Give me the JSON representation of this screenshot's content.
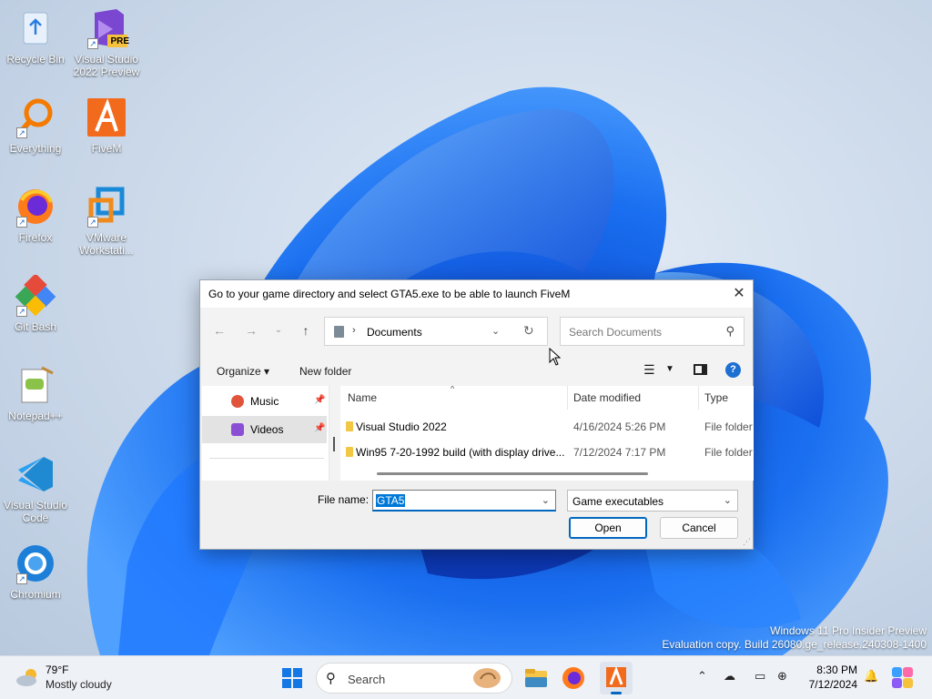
{
  "desktop": {
    "icons": [
      {
        "label": "Recycle Bin",
        "icon": "recycle-bin-icon"
      },
      {
        "label": "Visual Studio 2022 Preview",
        "icon": "visual-studio-preview-icon",
        "badge": "PRE"
      },
      {
        "label": "Everything",
        "icon": "everything-search-icon"
      },
      {
        "label": "FiveM",
        "icon": "fivem-icon"
      },
      {
        "label": "Firefox",
        "icon": "firefox-icon"
      },
      {
        "label": "VMware Workstati...",
        "icon": "vmware-icon"
      },
      {
        "label": "Git Bash",
        "icon": "git-bash-icon"
      },
      {
        "label": "Notepad++",
        "icon": "notepadpp-icon"
      },
      {
        "label": "Visual Studio Code",
        "icon": "vscode-icon"
      },
      {
        "label": "Chromium",
        "icon": "chromium-icon"
      }
    ],
    "watermark": {
      "line1": "Windows 11 Pro Insider Preview",
      "line2": "Evaluation copy. Build 26080.ge_release.240308-1400"
    }
  },
  "dialog": {
    "title": "Go to your game directory and select GTA5.exe to be able to launch FiveM",
    "close_icon": "close-icon",
    "address": {
      "separator": "›",
      "current": "Documents"
    },
    "search_placeholder": "Search Documents",
    "toolbar": {
      "organize": "Organize ▾",
      "new_folder": "New folder"
    },
    "nav_items": [
      {
        "label": "Music",
        "color": "#e0543a"
      },
      {
        "label": "Videos",
        "color": "#8a4fd4",
        "selected": true
      }
    ],
    "columns": {
      "name": "Name",
      "date": "Date modified",
      "type": "Type"
    },
    "rows": [
      {
        "name": "Visual Studio 2022",
        "date": "4/16/2024 5:26 PM",
        "type": "File folder"
      },
      {
        "name": "Win95 7-20-1992 build (with display drive...",
        "date": "7/12/2024 7:17 PM",
        "type": "File folder"
      }
    ],
    "file_name_label": "File name:",
    "file_name_value": "GTA5",
    "file_type_value": "Game executables",
    "open_label": "Open",
    "cancel_label": "Cancel"
  },
  "taskbar": {
    "weather": {
      "temp": "79°F",
      "condition": "Mostly cloudy"
    },
    "search_label": "Search",
    "clock": {
      "time": "8:30 PM",
      "date": "7/12/2024"
    },
    "accent": "#0067c0"
  }
}
